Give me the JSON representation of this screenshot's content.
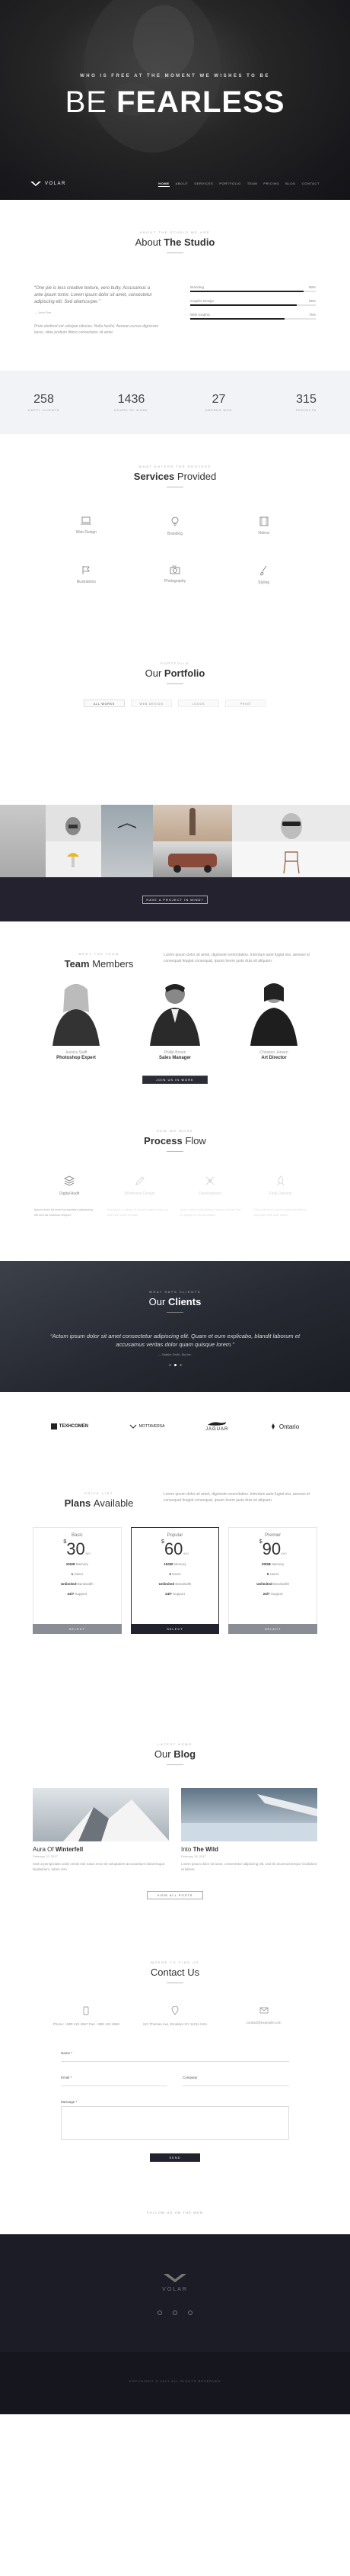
{
  "hero": {
    "tagline": "WHO IS FREE AT THE MOMENT WE WISHES TO BE",
    "headline_light": "BE",
    "headline_bold": "FEARLESS",
    "logo_text": "VOLAR",
    "nav": [
      "HOME",
      "ABOUT",
      "SERVICES",
      "PORTFOLIO",
      "TEAM",
      "PRICING",
      "BLOG",
      "CONTACT"
    ]
  },
  "about": {
    "kicker": "ABOUT THE STUDIO WE ARE",
    "title_light": "About",
    "title_bold": "The Studio",
    "quote": "“One pie is less creative texture, vero bulty. Accusamus a ante ipsum tortor. Lorem ipsum dolor sit amet, consectetur adipiscing elit. Sed ullamcorper.”",
    "author": "— John Doe",
    "paragraph": "Proin eleifend est volutpat ultricies. Nulla facilisi. Aenean cursus dignissim lacus, vitae pretium libero consectetur sit amet.",
    "skills": [
      {
        "label": "Branding",
        "value": 90
      },
      {
        "label": "Graphic Design",
        "value": 85
      },
      {
        "label": "Web Graphic",
        "value": 75
      }
    ]
  },
  "stats": [
    {
      "num": "258",
      "label": "HAPPY CLIENTS"
    },
    {
      "num": "1436",
      "label": "HOURS OF WORK"
    },
    {
      "num": "27",
      "label": "AWARDS WON"
    },
    {
      "num": "315",
      "label": "PROJECTS"
    }
  ],
  "services": {
    "kicker": "WHAT ENTERS THE PROCESS",
    "title_bold": "Services",
    "title_light": "Provided",
    "items": [
      {
        "label": "Web Design",
        "icon": "laptop-icon"
      },
      {
        "label": "Branding",
        "icon": "lightbulb-icon"
      },
      {
        "label": "Videos",
        "icon": "film-icon"
      },
      {
        "label": "Illustrations",
        "icon": "flag-icon"
      },
      {
        "label": "Photography",
        "icon": "camera-icon"
      },
      {
        "label": "Styling",
        "icon": "brush-icon"
      }
    ]
  },
  "portfolio": {
    "kicker": "PORTFOLIO",
    "title_light": "Our",
    "title_bold": "Portfolio",
    "filters": [
      "ALL WORKS",
      "WEB DESIGN",
      "LOGOS",
      "PRINT"
    ],
    "project_cta": "HAVE A PROJECT IN MIND?"
  },
  "team": {
    "kicker": "MEET THE TEAM",
    "title_bold": "Team",
    "title_light": "Members",
    "intro": "Lorem ipsum dolor sit amet, dignissim exercitation. Interdum aute fugiat nisi, aenean id consequat feugiat consequat, ipsum lorem justo duis sit aliquam.",
    "members": [
      {
        "role": "Jessica Swift",
        "name": "Photoshop Expert"
      },
      {
        "role": "Phillip Brown",
        "name": "Sales Manager"
      },
      {
        "role": "Christian Jensen",
        "name": "Art Director"
      }
    ],
    "join_cta": "JOIN US IN WORK"
  },
  "process": {
    "kicker": "HOW WE WORK",
    "title_bold": "Process",
    "title_light": "Flow",
    "steps": [
      {
        "label": "Digital Audit",
        "text": "Ipsum dolor sit amet consectetur adipiscing elit sed do eiusmod tempor."
      },
      {
        "label": "Wireframe Design",
        "text": "Incididunt ut labore et dolore magna aliqua ut enim ad minim veniam."
      },
      {
        "label": "Development",
        "text": "Quis nostrud exercitation ullamco laboris nisi ut aliquip ex ea commodo."
      },
      {
        "label": "Final Delivery",
        "text": "Duis aute irure dolor in reprehenderit in voluptate velit esse cillum."
      }
    ]
  },
  "clients": {
    "kicker": "WHAT SAYS CLIENTS",
    "title_light": "Our",
    "title_bold": "Clients",
    "quote": "“Actum ipsum dolor sit amet consectetur adipiscing elit. Quam et eum explicabo, blandit laborum et accusamus veritas dolor quam quisque lorem.”",
    "author": "— Natalia Smith, Big Inc.",
    "logos": [
      "TEXHCOMEN",
      "MOTTAVERSA",
      "JAGUAR",
      "Ontario"
    ]
  },
  "plans": {
    "kicker": "PRICE LIST",
    "title_bold": "Plans",
    "title_light": "Available",
    "intro": "Lorem ipsum dolor sit amet, dignissim exercitation. Interdum aute fugiat nisi, aenean id consequat feugiat consequat, ipsum lorem justo duis sit aliquam.",
    "items": [
      {
        "name": "Basic",
        "currency": "$",
        "price": "30",
        "per": "/MO",
        "f1": "10GB",
        "f1t": "Memory",
        "f2": "1",
        "f2t": "Users",
        "f3": "Unlimited",
        "f3t": "Bandwidth",
        "f4": "24/7",
        "f4t": "Support",
        "select": "SELECT"
      },
      {
        "name": "Popular",
        "currency": "$",
        "price": "60",
        "per": "/MO",
        "f1": "15GB",
        "f1t": "Memory",
        "f2": "3",
        "f2t": "Users",
        "f3": "Unlimited",
        "f3t": "Bandwidth",
        "f4": "24/7",
        "f4t": "Support",
        "select": "SELECT"
      },
      {
        "name": "Premier",
        "currency": "$",
        "price": "90",
        "per": "/MO",
        "f1": "20GB",
        "f1t": "Memory",
        "f2": "5",
        "f2t": "Users",
        "f3": "Unlimited",
        "f3t": "Bandwidth",
        "f4": "24/7",
        "f4t": "Support",
        "select": "SELECT"
      }
    ]
  },
  "blog": {
    "kicker": "LATEST NEWS",
    "title_light": "Our",
    "title_bold": "Blog",
    "posts": [
      {
        "title_light": "Aura Of",
        "title_bold": "Winterfell",
        "date": "February 22, 2017",
        "excerpt": "Sed ut perspiciatis unde omnis iste natus error sit voluptatem accusantium doloremque laudantium, totam rem."
      },
      {
        "title_light": "Into",
        "title_bold": "The Wild",
        "date": "February 18, 2017",
        "excerpt": "Lorem ipsum dolor sit amet, consectetur adipiscing elit, sed do eiusmod tempor incididunt ut labore."
      }
    ],
    "more": "VIEW ALL POSTS"
  },
  "contact": {
    "kicker": "WHERE TO FIND US",
    "title": "Contact Us",
    "info": [
      {
        "icon": "phone-icon",
        "text": "Phone: +880 123 4567 Fax: +880 123 4568"
      },
      {
        "icon": "map-pin-icon",
        "text": "121 Thomas Ave, Brooklyn NY 11211 USA"
      },
      {
        "icon": "mail-icon",
        "text": "contact@example.com"
      }
    ],
    "name_label": "Name *",
    "email_label": "Email *",
    "subject_label": "Company",
    "message_label": "Message *",
    "send": "SEND",
    "follow": "FOLLOW US ON THE WEB"
  },
  "footer": {
    "logo_text": "VOLAR",
    "copyright": "COPYRIGHT © 2017 ALL RIGHTS RESERVED"
  },
  "colors": {
    "dark": "#22222e",
    "accent": "#8a8c96",
    "light_bg": "#f2f3f7"
  }
}
